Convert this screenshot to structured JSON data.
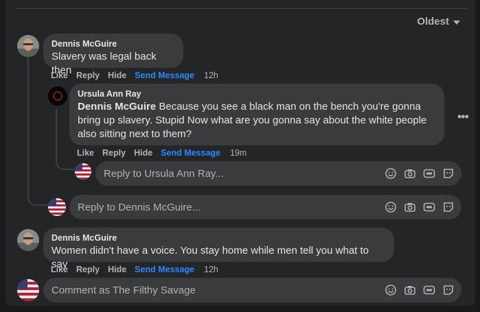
{
  "sort_label": "Oldest",
  "top_partial_text": "...",
  "comments": [
    {
      "author": "Dennis McGuire",
      "text": "Slavery was legal back then",
      "actions": [
        "Like",
        "Reply",
        "Hide",
        "Send Message"
      ],
      "time": "12h"
    },
    {
      "author": "Ursula Ann Ray",
      "mention": "Dennis McGuire",
      "text": " Because you see a black man on the bench you're gonna bring up slavery. Stupid Now what are you gonna say about the white people also sitting next to them?",
      "actions": [
        "Like",
        "Reply",
        "Hide",
        "Send Message"
      ],
      "time": "19m"
    },
    {
      "author": "Dennis McGuire",
      "text": "Women didn't have a voice. You stay home while men tell you what to say",
      "actions": [
        "Like",
        "Reply",
        "Hide",
        "Send Message"
      ],
      "time": "12h"
    }
  ],
  "inputs": {
    "reply_ursula": "Reply to Ursula Ann Ray...",
    "reply_dennis": "Reply to Dennis McGuire...",
    "comment_as": "Comment as The Filthy Savage"
  },
  "icons": [
    "emoji-icon",
    "camera-icon",
    "gif-icon",
    "sticker-icon"
  ],
  "colors": {
    "link": "#2d88ff",
    "bubble": "#3a3b3c",
    "panel": "#242526"
  }
}
